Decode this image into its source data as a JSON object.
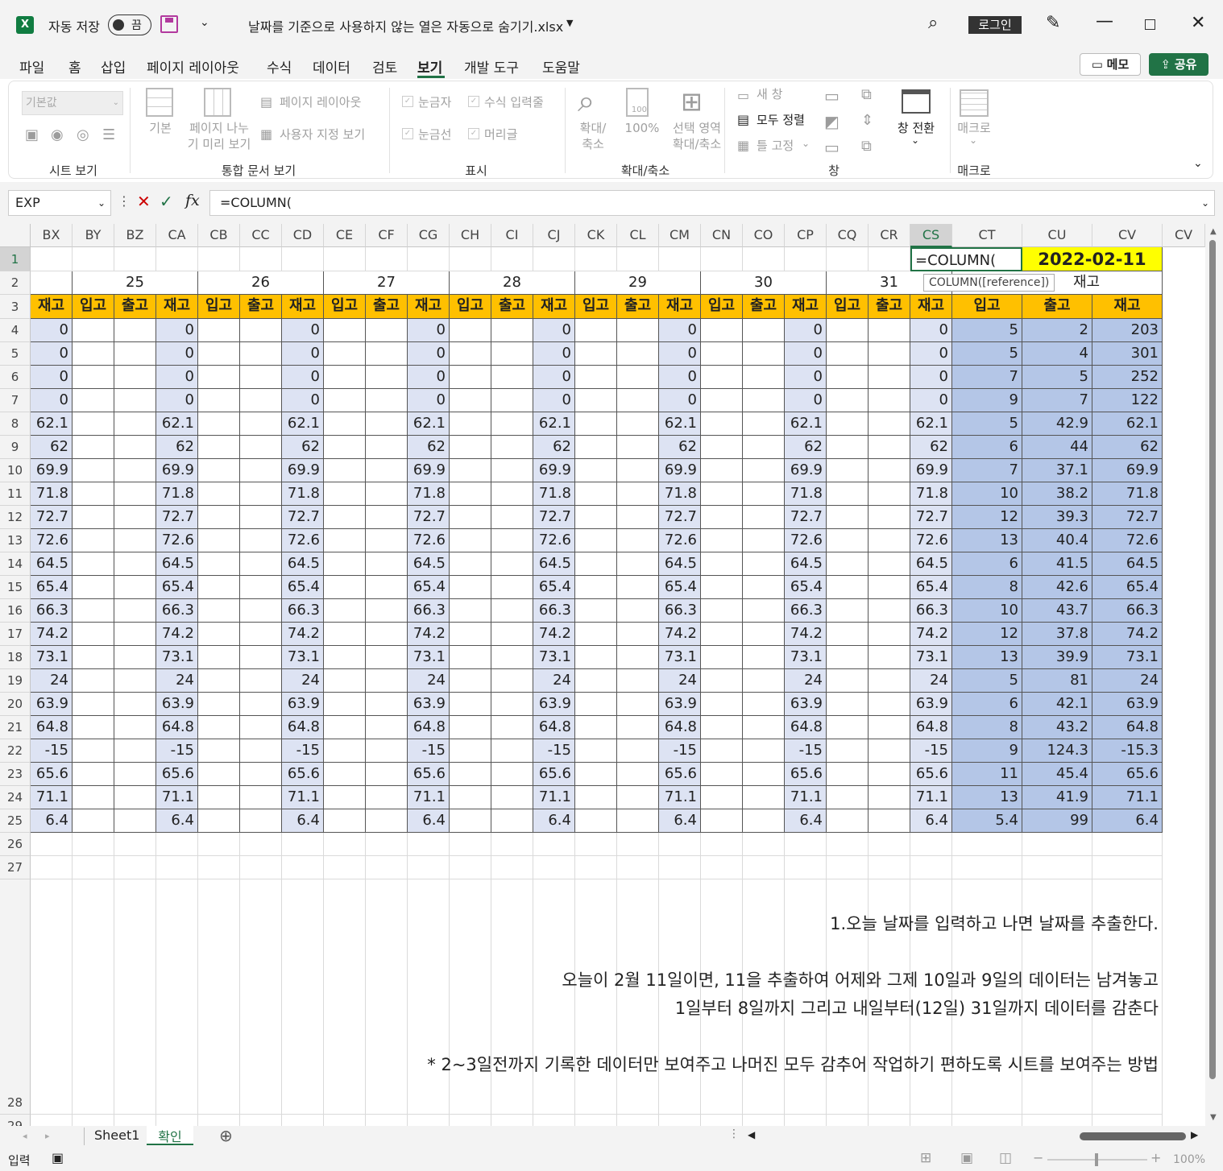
{
  "titlebar": {
    "autosave_label": "자동 저장",
    "autosave_state": "끔",
    "filename": "날짜를 기준으로 사용하지 않는 열은 자동으로 숨기기.xlsx",
    "login_label": "로그인"
  },
  "menu": {
    "items": [
      "파일",
      "홈",
      "삽입",
      "페이지 레이아웃",
      "수식",
      "데이터",
      "검토",
      "보기",
      "개발 도구",
      "도움말"
    ],
    "active": "보기",
    "memo_label": "메모",
    "share_label": "공유"
  },
  "ribbon": {
    "sheetview": {
      "dropdown": "기본값",
      "group": "시트 보기"
    },
    "workbook": {
      "normal": "기본",
      "pagebreak1": "페이지 나누",
      "pagebreak2": "기 미리 보기",
      "pagelayout": "페이지 레이아웃",
      "custom": "사용자 지정 보기",
      "group": "통합 문서 보기"
    },
    "show": {
      "ruler": "눈금자",
      "formulabar": "수식 입력줄",
      "gridlines": "눈금선",
      "headings": "머리글",
      "group": "표시"
    },
    "zoom": {
      "zoom1": "확대/",
      "zoom2": "축소",
      "hundred": "100%",
      "sel1": "선택 영역",
      "sel2": "확대/축소",
      "group": "확대/축소"
    },
    "window": {
      "newwin": "새 창",
      "arrange": "모두 정렬",
      "freeze": "틀 고정",
      "switch": "창 전환",
      "group": "창"
    },
    "macro": {
      "label": "매크로",
      "group": "매크로"
    }
  },
  "formula_bar": {
    "name_box": "EXP",
    "fx": "fx",
    "formula": "=COLUMN("
  },
  "columns": [
    "BX",
    "BY",
    "BZ",
    "CA",
    "CB",
    "CC",
    "CD",
    "CE",
    "CF",
    "CG",
    "CH",
    "CI",
    "CJ",
    "CK",
    "CL",
    "CM",
    "CN",
    "CO",
    "CP",
    "CQ",
    "CR",
    "CS",
    "CT",
    "CU",
    "CV",
    "CV"
  ],
  "rows": [
    "1",
    "2",
    "3",
    "4",
    "5",
    "6",
    "7",
    "8",
    "9",
    "10",
    "11",
    "12",
    "13",
    "14",
    "15",
    "16",
    "17",
    "18",
    "19",
    "20",
    "21",
    "22",
    "23",
    "24",
    "25",
    "26",
    "27",
    "28",
    "29"
  ],
  "sheet": {
    "active_cell_text": "=COLUMN(",
    "date_cell": "2022-02-11",
    "tooltip": "COLUMN([reference])",
    "partial_header": "재고",
    "days": [
      "25",
      "26",
      "27",
      "28",
      "29",
      "30",
      "31"
    ],
    "header_in": "입고",
    "header_out": "출고",
    "header_stock": "재고",
    "stock_values": [
      "0",
      "0",
      "0",
      "0",
      "62.1",
      "62",
      "69.9",
      "71.8",
      "72.7",
      "72.6",
      "64.5",
      "65.4",
      "66.3",
      "74.2",
      "73.1",
      "24",
      "63.9",
      "64.8",
      "-15",
      "65.6",
      "71.1",
      "6.4"
    ],
    "summary_in": [
      "5",
      "5",
      "7",
      "9",
      "5",
      "6",
      "7",
      "10",
      "12",
      "13",
      "6",
      "8",
      "10",
      "12",
      "13",
      "5",
      "6",
      "8",
      "9",
      "11",
      "13",
      "5.4"
    ],
    "summary_out": [
      "2",
      "4",
      "5",
      "7",
      "42.9",
      "44",
      "37.1",
      "38.2",
      "39.3",
      "40.4",
      "41.5",
      "42.6",
      "43.7",
      "37.8",
      "39.9",
      "81",
      "42.1",
      "43.2",
      "124.3",
      "45.4",
      "41.9",
      "99"
    ],
    "summary_stock": [
      "203",
      "301",
      "252",
      "122",
      "62.1",
      "62",
      "69.9",
      "71.8",
      "72.7",
      "72.6",
      "64.5",
      "65.4",
      "66.3",
      "74.2",
      "73.1",
      "24",
      "63.9",
      "64.8",
      "-15.3",
      "65.6",
      "71.1",
      "6.4"
    ]
  },
  "notes": {
    "line1": "1.오늘 날짜를 입력하고 나면 날짜를 추출한다.",
    "line2": "오늘이 2월 11일이면,  11을 추출하여 어제와 그제 10일과 9일의 데이터는 남겨놓고",
    "line3": "1일부터 8일까지 그리고 내일부터(12일) 31일까지 데이터를 감춘다",
    "line4": "* 2~3일전까지 기록한 데이터만 보여주고 나머진 모두 감추어 작업하기 편하도록 시트를 보여주는 방법"
  },
  "tabs": {
    "sheet1": "Sheet1",
    "sheet2": "확인"
  },
  "status": {
    "mode": "입력",
    "zoom": "100%"
  },
  "colors": {
    "header_orange": "#ffc000",
    "date_yellow": "#ffff00",
    "light_blue": "#dde3f3",
    "mid_blue": "#b4c6e7",
    "excel_green": "#217346"
  }
}
